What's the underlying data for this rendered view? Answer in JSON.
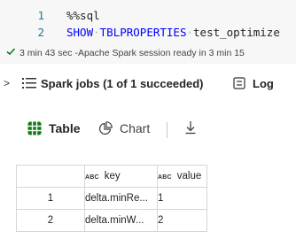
{
  "code": {
    "lines": [
      {
        "number": "1",
        "text": "%%sql"
      },
      {
        "number": "2",
        "keyword1": "SHOW",
        "keyword2": "TBLPROPERTIES",
        "identifier": "test_optimize"
      }
    ]
  },
  "status": {
    "text": "3 min 43 sec -Apache Spark session ready in 3 min 15"
  },
  "jobs": {
    "label": "Spark jobs (1 of 1 succeeded)",
    "log_label": "Log"
  },
  "tabs": {
    "table": "Table",
    "chart": "Chart"
  },
  "table": {
    "type_badge": "ABC",
    "columns": [
      "key",
      "value"
    ],
    "rows": [
      {
        "index": "1",
        "key": "delta.minRe...",
        "value": "1"
      },
      {
        "index": "2",
        "key": "delta.minW...",
        "value": "2"
      }
    ]
  },
  "colors": {
    "keyword": "#0000ff",
    "line_number": "#237893",
    "success": "#107c10"
  }
}
